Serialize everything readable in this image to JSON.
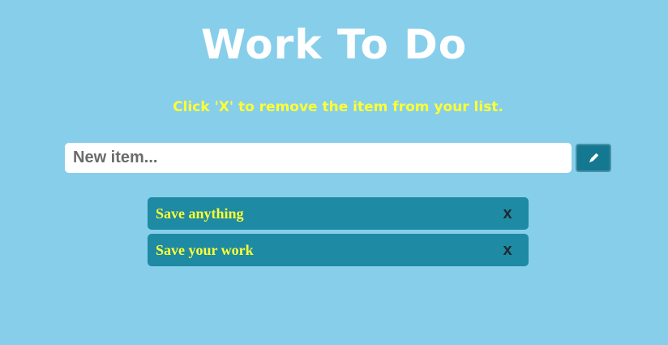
{
  "header": {
    "title": "Work To Do",
    "instructions": "Click 'X' to remove the item from your list."
  },
  "input": {
    "value": "",
    "placeholder": "New item..."
  },
  "add_button": {
    "icon": "pencil-icon"
  },
  "todos": [
    {
      "text": "Save anything",
      "remove_label": "x"
    },
    {
      "text": "Save your work",
      "remove_label": "x"
    }
  ],
  "colors": {
    "background": "#87ceeb",
    "title": "#ffffff",
    "accent_text": "#ffff33",
    "item_background": "#1e8aa3",
    "button_background": "#147890"
  }
}
